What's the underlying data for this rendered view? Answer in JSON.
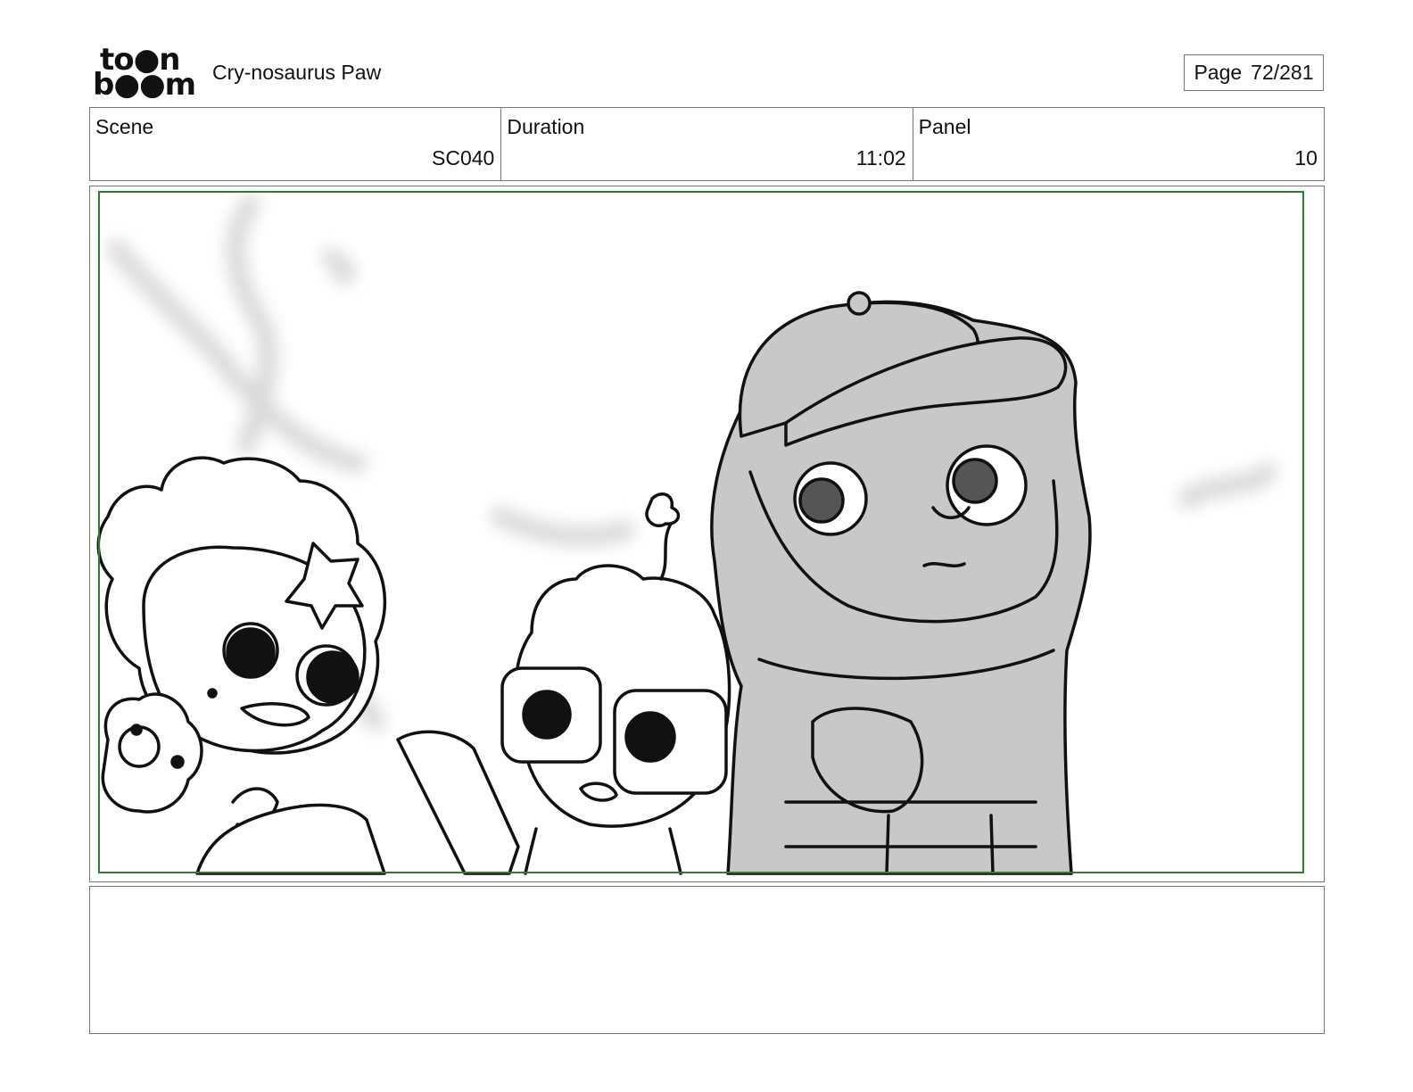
{
  "header": {
    "logo_top": "to●n",
    "logo_bottom": "b●●m",
    "project_title": "Cry-nosaurus Paw",
    "page_label": "Page",
    "page_value": "72/281"
  },
  "info": {
    "scene_label": "Scene",
    "scene_value": "SC040",
    "duration_label": "Duration",
    "duration_value": "11:02",
    "panel_label": "Panel",
    "panel_value": "10"
  },
  "colors": {
    "safe_frame": "#2e7d32",
    "border": "#777777",
    "ink": "#111111",
    "fill_gray": "#c8c8c8"
  }
}
